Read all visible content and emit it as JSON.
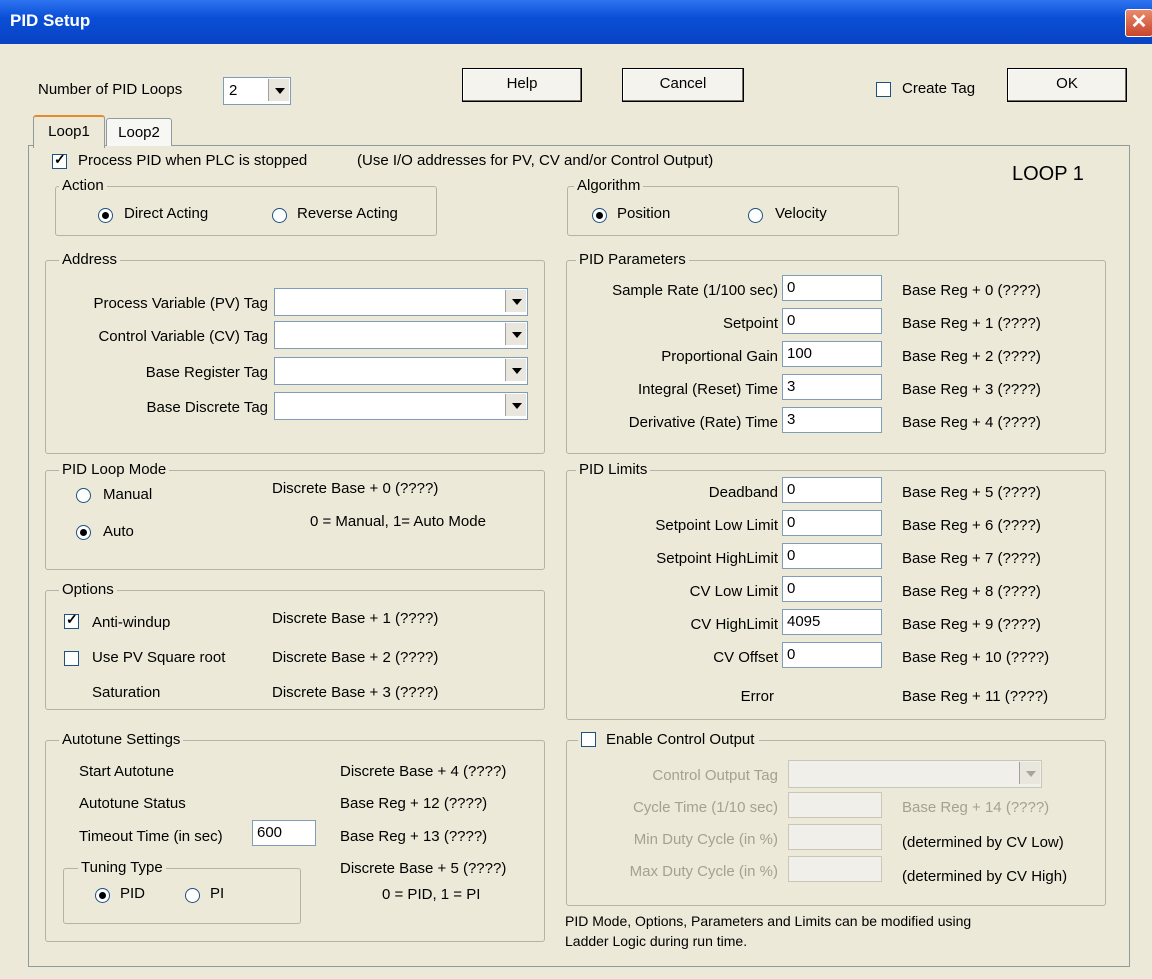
{
  "window": {
    "title": "PID Setup",
    "close": "✕"
  },
  "top": {
    "num_loops_label": "Number of PID Loops",
    "num_loops_value": "2",
    "help": "Help",
    "cancel": "Cancel",
    "create_tag": "Create Tag",
    "ok": "OK"
  },
  "tabs": [
    "Loop1",
    "Loop2"
  ],
  "loop_title": "LOOP 1",
  "process_pid": "Process PID when PLC is stopped",
  "process_pid_note": "(Use I/O addresses for PV, CV and/or Control Output)",
  "action": {
    "title": "Action",
    "direct": "Direct Acting",
    "reverse": "Reverse Acting"
  },
  "algorithm": {
    "title": "Algorithm",
    "position": "Position",
    "velocity": "Velocity"
  },
  "address": {
    "title": "Address",
    "pv": "Process Variable (PV) Tag",
    "cv": "Control Variable (CV) Tag",
    "base_reg": "Base Register Tag",
    "base_disc": "Base Discrete Tag"
  },
  "pid_params": {
    "title": "PID Parameters",
    "rows": [
      {
        "label": "Sample Rate (1/100 sec)",
        "value": "0",
        "reg": "Base Reg + 0 (????)"
      },
      {
        "label": "Setpoint",
        "value": "0",
        "reg": "Base Reg + 1 (????)"
      },
      {
        "label": "Proportional Gain",
        "value": "100",
        "reg": "Base Reg + 2 (????)"
      },
      {
        "label": "Integral (Reset) Time",
        "value": "3",
        "reg": "Base Reg + 3 (????)"
      },
      {
        "label": "Derivative (Rate) Time",
        "value": "3",
        "reg": "Base Reg + 4 (????)"
      }
    ]
  },
  "loop_mode": {
    "title": "PID Loop Mode",
    "manual": "Manual",
    "auto": "Auto",
    "disc": "Discrete Base + 0 (????)",
    "note": "0 = Manual,   1= Auto Mode"
  },
  "pid_limits": {
    "title": "PID Limits",
    "rows": [
      {
        "label": "Deadband",
        "value": "0",
        "reg": "Base Reg + 5 (????)"
      },
      {
        "label": "Setpoint Low Limit",
        "value": "0",
        "reg": "Base Reg + 6 (????)"
      },
      {
        "label": "Setpoint HighLimit",
        "value": "0",
        "reg": "Base Reg + 7 (????)"
      },
      {
        "label": "CV Low Limit",
        "value": "0",
        "reg": "Base Reg + 8 (????)"
      },
      {
        "label": "CV HighLimit",
        "value": "4095",
        "reg": "Base Reg + 9 (????)"
      },
      {
        "label": "CV Offset",
        "value": "0",
        "reg": "Base Reg + 10 (????)"
      }
    ],
    "error_label": "Error",
    "error_reg": "Base Reg + 11 (????)"
  },
  "options": {
    "title": "Options",
    "antiwindup": "Anti-windup",
    "antiwindup_reg": "Discrete Base + 1 (????)",
    "sqrt": "Use PV Square root",
    "sqrt_reg": "Discrete Base + 2 (????)",
    "saturation": "Saturation",
    "saturation_reg": "Discrete Base + 3 (????)"
  },
  "autotune": {
    "title": "Autotune Settings",
    "start": "Start Autotune",
    "start_reg": "Discrete Base + 4 (????)",
    "status": "Autotune Status",
    "status_reg": "Base Reg + 12 (????)",
    "timeout": "Timeout Time (in sec)",
    "timeout_value": "600",
    "timeout_reg": "Base Reg + 13 (????)",
    "tuning_type": "Tuning Type",
    "pid": "PID",
    "pi": "PI",
    "tuning_reg": "Discrete Base + 5 (????)",
    "tuning_note": "0 = PID,  1 = PI"
  },
  "control_output": {
    "title": "Enable Control Output",
    "tag": "Control Output Tag",
    "cycle": "Cycle Time (1/10 sec)",
    "cycle_reg": "Base Reg + 14 (????)",
    "min": "Min Duty Cycle (in %)",
    "min_note": "(determined by CV Low)",
    "max": "Max Duty Cycle (in %)",
    "max_note": "(determined by CV High)"
  },
  "footer_note_1": "PID Mode, Options, Parameters and Limits can be modified using",
  "footer_note_2": "Ladder Logic during run time."
}
